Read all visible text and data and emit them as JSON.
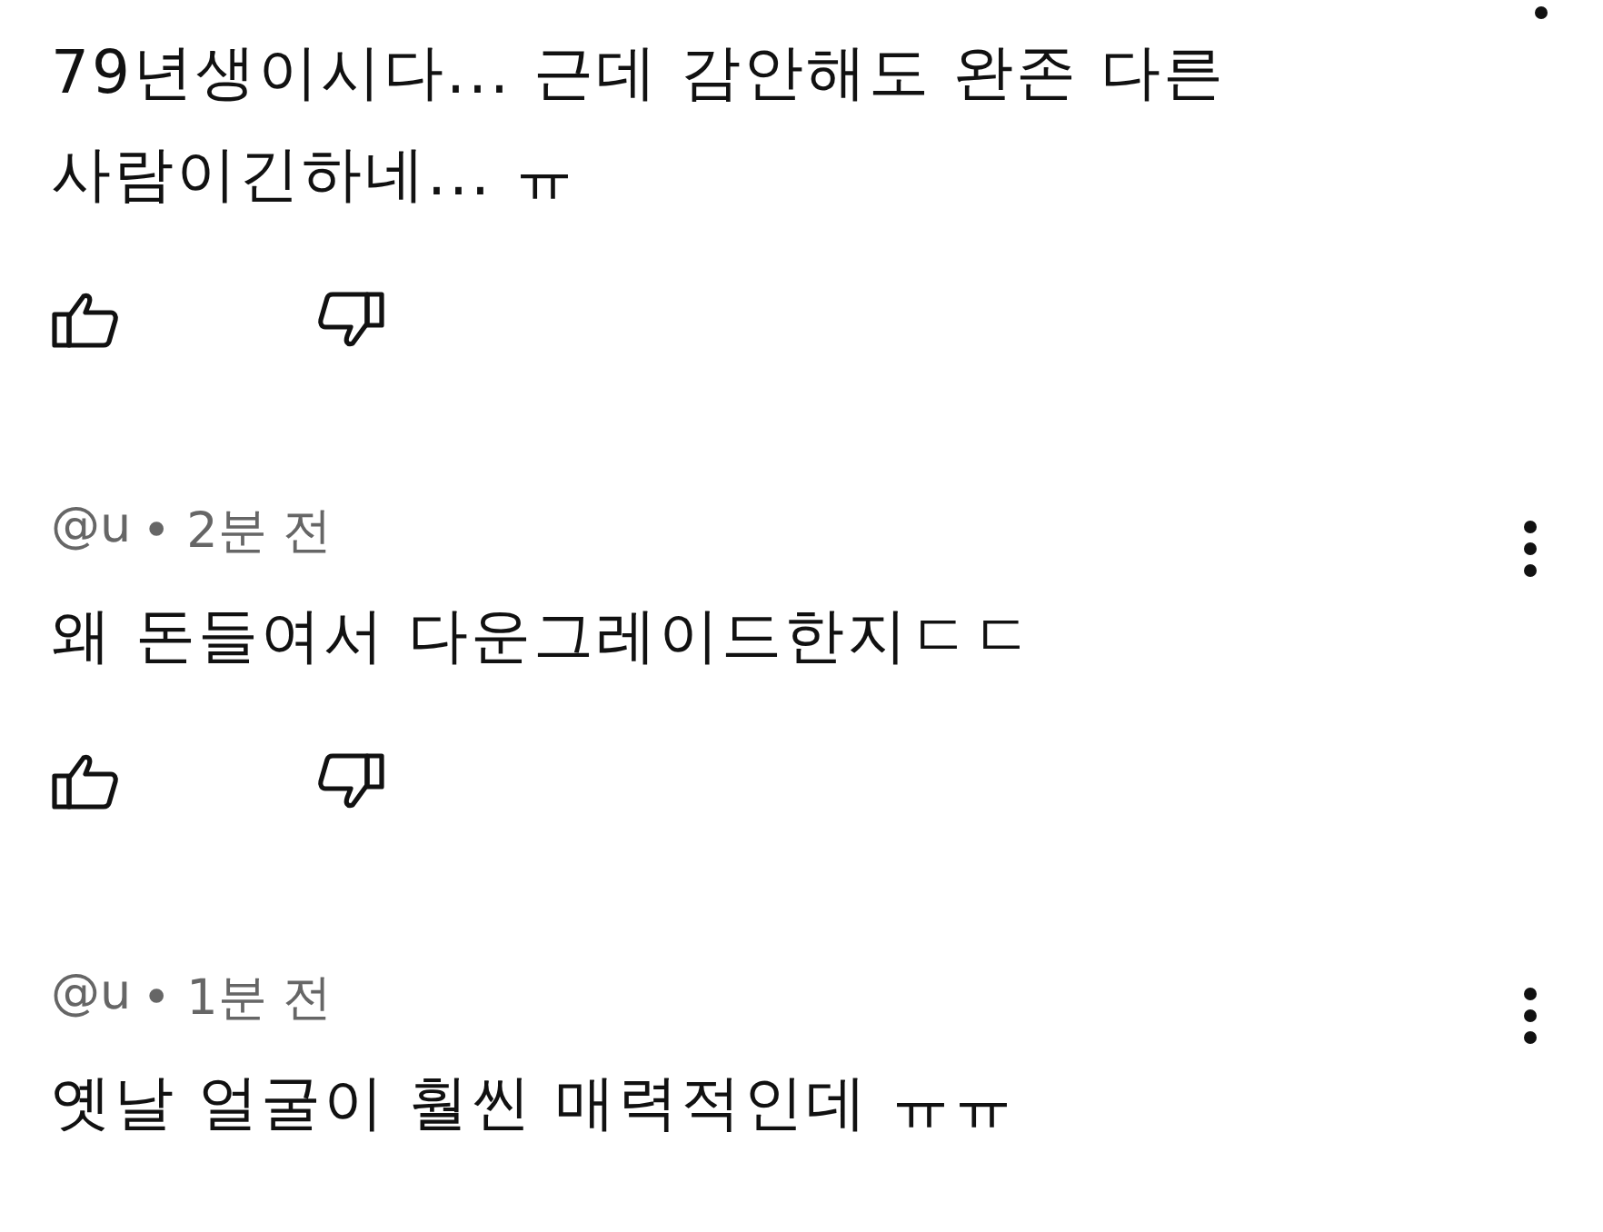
{
  "comments": [
    {
      "body": "79년생이시다...  근데 감안해도 완존 다른 사람이긴하네... ㅠ"
    },
    {
      "author": "@u",
      "time": "• 2분 전",
      "body": "왜 돈들여서 다운그레이드한지ㄷㄷ"
    },
    {
      "author": "@u",
      "time": "• 1분 전",
      "body": "옛날 얼굴이 훨씬 매력적인데 ㅠㅠ"
    }
  ]
}
